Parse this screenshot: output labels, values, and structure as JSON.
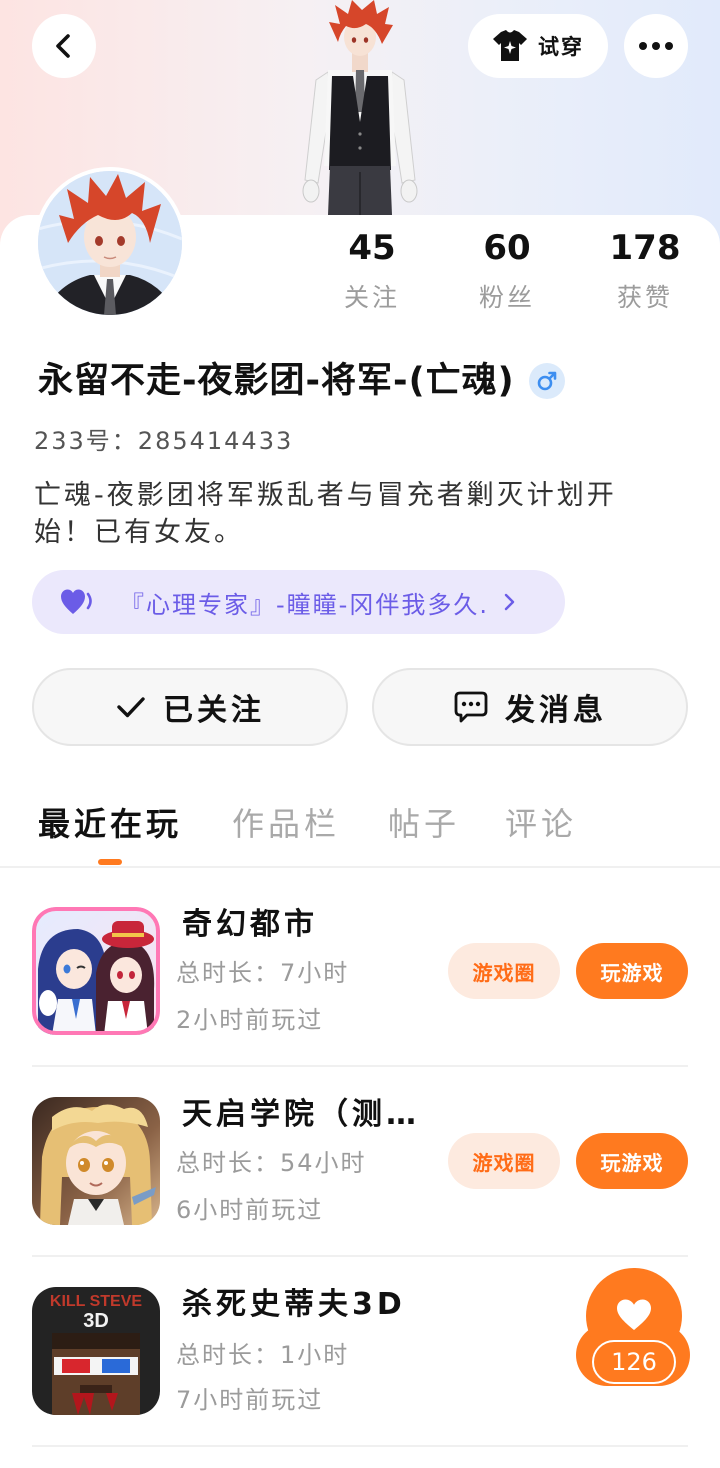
{
  "header": {
    "back_icon": "chevron-left-icon",
    "try_on_icon": "shirt-icon",
    "try_on_label": "试穿",
    "more_icon": "more-dots-icon"
  },
  "profile": {
    "stats": [
      {
        "value": "45",
        "label": "关注"
      },
      {
        "value": "60",
        "label": "粉丝"
      },
      {
        "value": "178",
        "label": "获赞"
      }
    ],
    "name": "永留不走-夜影团-将军-(亡魂)",
    "gender_icon": "male-icon",
    "id_line": "233号：285414433",
    "bio": "亡魂-夜影团将军叛乱者与冒充者剿灭计划开始！已有女友。",
    "relation_tag": {
      "icon": "heart-icon",
      "text": "『心理专家』-瞳瞳-冈伴我多久.",
      "arrow_icon": "chevron-right-icon"
    }
  },
  "actions": {
    "follow_icon": "check-icon",
    "follow_label": "已关注",
    "message_icon": "chat-bubble-icon",
    "message_label": "发消息"
  },
  "tabs": [
    {
      "label": "最近在玩",
      "active": true
    },
    {
      "label": "作品栏",
      "active": false
    },
    {
      "label": "帖子",
      "active": false
    },
    {
      "label": "评论",
      "active": false
    }
  ],
  "games": [
    {
      "title": "奇幻都市",
      "duration": "总时长：7小时",
      "last_played": "2小时前玩过",
      "circle_label": "游戏圈",
      "play_label": "玩游戏"
    },
    {
      "title": "天启学院（测…",
      "duration": "总时长：54小时",
      "last_played": "6小时前玩过",
      "circle_label": "游戏圈",
      "play_label": "玩游戏"
    },
    {
      "title": "杀死史蒂夫3D",
      "duration": "总时长：1小时",
      "last_played": "7小时前玩过",
      "icon_logo_line1": "KILL STEVE",
      "icon_logo_line2": "3D"
    }
  ],
  "floating_like": {
    "icon": "heart-icon",
    "count": "126"
  },
  "colors": {
    "accent_orange": "#ff7a1f",
    "orange_soft_bg": "#fdeadf",
    "purple_text": "#6b5ce7",
    "purple_bg": "#ebe8fc",
    "male_blue": "#3d8ef0",
    "hair_red": "#d6462a"
  }
}
